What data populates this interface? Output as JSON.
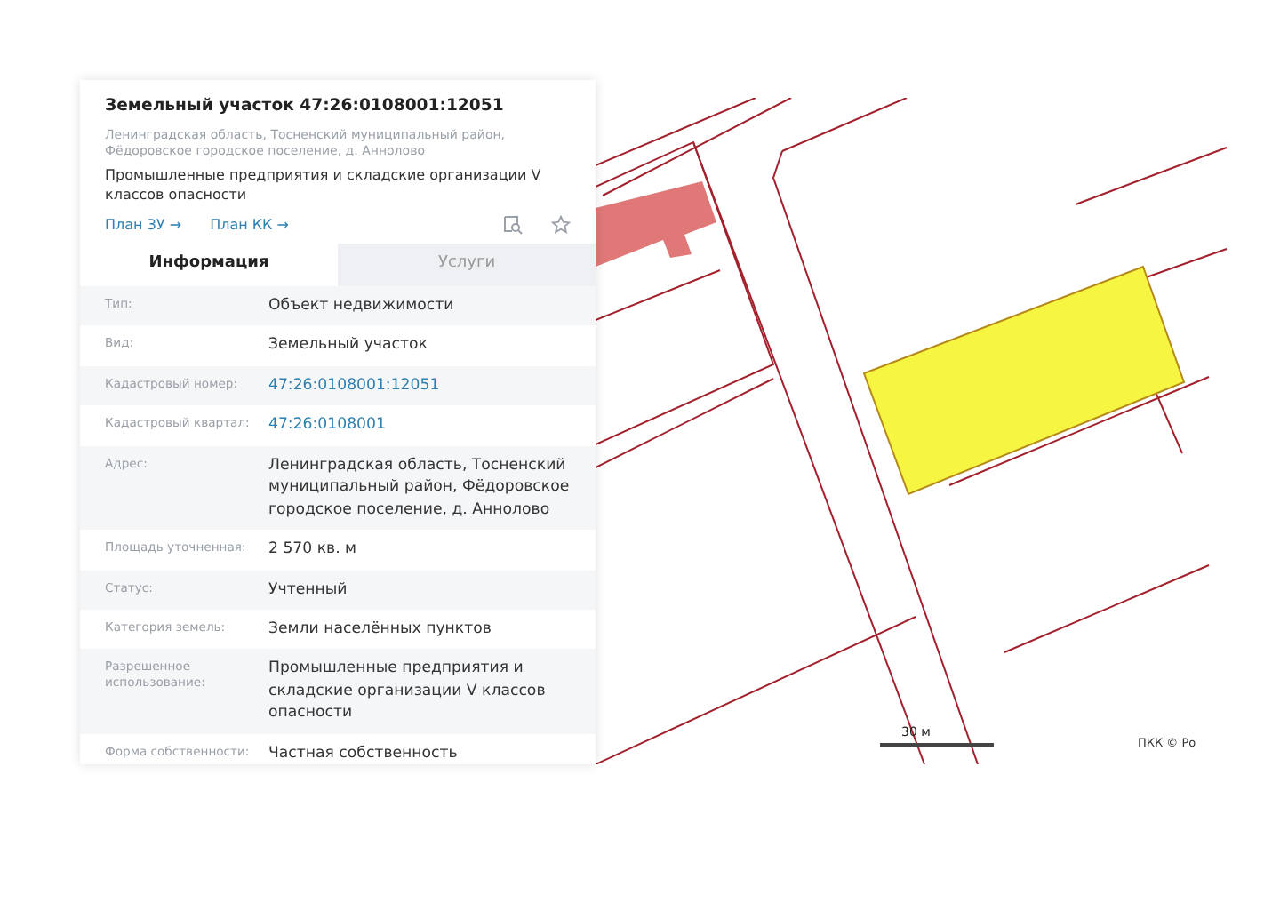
{
  "card": {
    "title": "Земельный участок 47:26:0108001:12051",
    "address": "Ленинградская область, Тосненский муниципальный район, Фёдоровское городское поселение, д. Аннолово",
    "purpose": "Промышленные предприятия и складские организации V классов опасности",
    "links": [
      "План ЗУ →",
      "План КК →"
    ]
  },
  "tabs": [
    {
      "label": "Информация",
      "selected": true
    },
    {
      "label": "Услуги",
      "selected": false
    }
  ],
  "rows": [
    {
      "label": "Тип:",
      "value": "Объект недвижимости",
      "kind": "text"
    },
    {
      "label": "Вид:",
      "value": "Земельный участок",
      "kind": "text"
    },
    {
      "label": "Кадастровый номер:",
      "value": "47:26:0108001:12051",
      "kind": "link"
    },
    {
      "label": "Кадастровый квартал:",
      "value": "47:26:0108001",
      "kind": "link"
    },
    {
      "label": "Адрес:",
      "value": "Ленинградская область, Тосненский муниципальный район, Фёдоровское городское поселение, д. Аннолово",
      "kind": "text"
    },
    {
      "label": "Площадь уточненная:",
      "value": "2 570 кв. м",
      "kind": "text"
    },
    {
      "label": "Статус:",
      "value": "Учтенный",
      "kind": "text"
    },
    {
      "label": "Категория земель:",
      "value": "Земли населённых пунктов",
      "kind": "text"
    },
    {
      "label": "Разрешенное использование:",
      "value": "Промышленные предприятия и складские организации V классов опасности",
      "kind": "text"
    },
    {
      "label": "Форма собственности:",
      "value": "Частная собственность",
      "kind": "text"
    }
  ],
  "map": {
    "kind": "picture",
    "scale": "30 м",
    "attribution": "ПКК © Ро"
  }
}
